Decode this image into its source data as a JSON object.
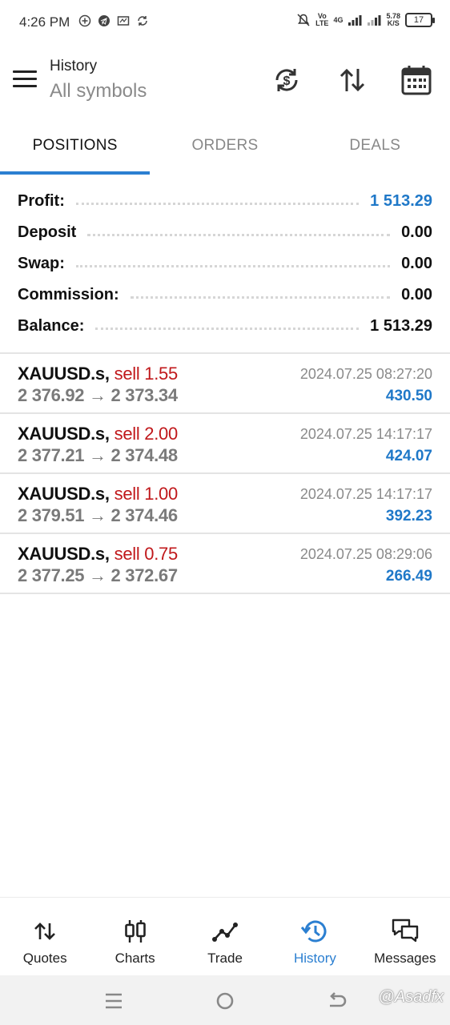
{
  "status_bar": {
    "time": "4:26 PM",
    "net_top": "Vo",
    "net_bottom": "LTE",
    "net_gen": "4G",
    "speed_top": "5.78",
    "speed_bottom": "K/S",
    "battery": "17"
  },
  "header": {
    "title": "History",
    "subtitle": "All symbols"
  },
  "tabs": [
    {
      "label": "POSITIONS",
      "active": true
    },
    {
      "label": "ORDERS",
      "active": false
    },
    {
      "label": "DEALS",
      "active": false
    }
  ],
  "summary": {
    "profit_label": "Profit:",
    "profit_value": "1 513.29",
    "deposit_label": "Deposit",
    "deposit_value": "0.00",
    "swap_label": "Swap:",
    "swap_value": "0.00",
    "commission_label": "Commission:",
    "commission_value": "0.00",
    "balance_label": "Balance:",
    "balance_value": "1 513.29"
  },
  "positions": [
    {
      "symbol": "XAUUSD.s,",
      "side": "sell 1.55",
      "prices": "2 376.92 → 2 373.34",
      "time": "2024.07.25 08:27:20",
      "profit": "430.50"
    },
    {
      "symbol": "XAUUSD.s,",
      "side": "sell 2.00",
      "prices": "2 377.21 → 2 374.48",
      "time": "2024.07.25 14:17:17",
      "profit": "424.07"
    },
    {
      "symbol": "XAUUSD.s,",
      "side": "sell 1.00",
      "prices": "2 379.51 → 2 374.46",
      "time": "2024.07.25 14:17:17",
      "profit": "392.23"
    },
    {
      "symbol": "XAUUSD.s,",
      "side": "sell 0.75",
      "prices": "2 377.25 → 2 372.67",
      "time": "2024.07.25 08:29:06",
      "profit": "266.49"
    }
  ],
  "bottom_nav": [
    {
      "label": "Quotes",
      "icon": "quotes-icon"
    },
    {
      "label": "Charts",
      "icon": "charts-icon"
    },
    {
      "label": "Trade",
      "icon": "trade-icon"
    },
    {
      "label": "History",
      "icon": "history-icon",
      "active": true
    },
    {
      "label": "Messages",
      "icon": "messages-icon"
    }
  ],
  "watermark": "@Asadfx",
  "colors": {
    "accent": "#2b7fd1",
    "profit": "#1f78c8",
    "sell": "#c0181b"
  }
}
